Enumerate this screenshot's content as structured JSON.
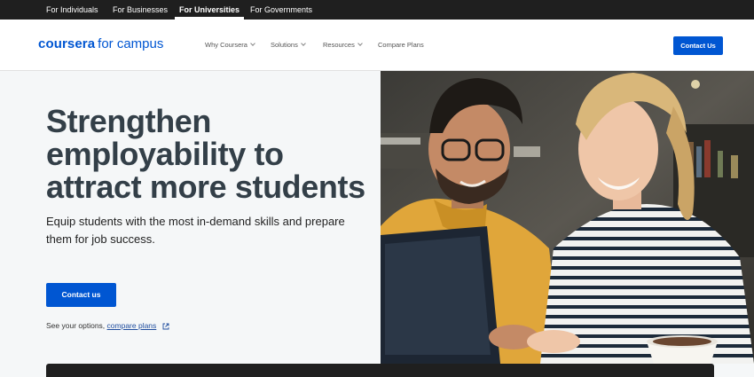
{
  "topbar": {
    "items": [
      {
        "label": "For Individuals",
        "active": false
      },
      {
        "label": "For Businesses",
        "active": false
      },
      {
        "label": "For Universities",
        "active": true
      },
      {
        "label": "For Governments",
        "active": false
      }
    ]
  },
  "nav": {
    "logo_brand": "coursera",
    "logo_sub": "for campus",
    "links": [
      {
        "label": "Why Coursera",
        "has_dropdown": true,
        "icon": "chevron-down-icon"
      },
      {
        "label": "Solutions",
        "has_dropdown": true,
        "icon": "chevron-down-icon"
      },
      {
        "label": "Resources",
        "has_dropdown": true,
        "icon": "chevron-down-icon"
      },
      {
        "label": "Compare Plans",
        "has_dropdown": false
      }
    ],
    "cta_label": "Contact Us"
  },
  "hero": {
    "headline": "Strengthen employability to attract more students",
    "subcopy": "Equip students with the most in-demand skills and prepare them for job success.",
    "cta_label": "Contact us",
    "options_prefix": "See your options,",
    "options_link": "compare plans",
    "options_icon": "external-link-icon"
  },
  "colors": {
    "brand": "#0056d2",
    "topbar_bg": "#1f1f1f",
    "hero_bg": "#f5f7f8",
    "headline": "#333f48"
  }
}
